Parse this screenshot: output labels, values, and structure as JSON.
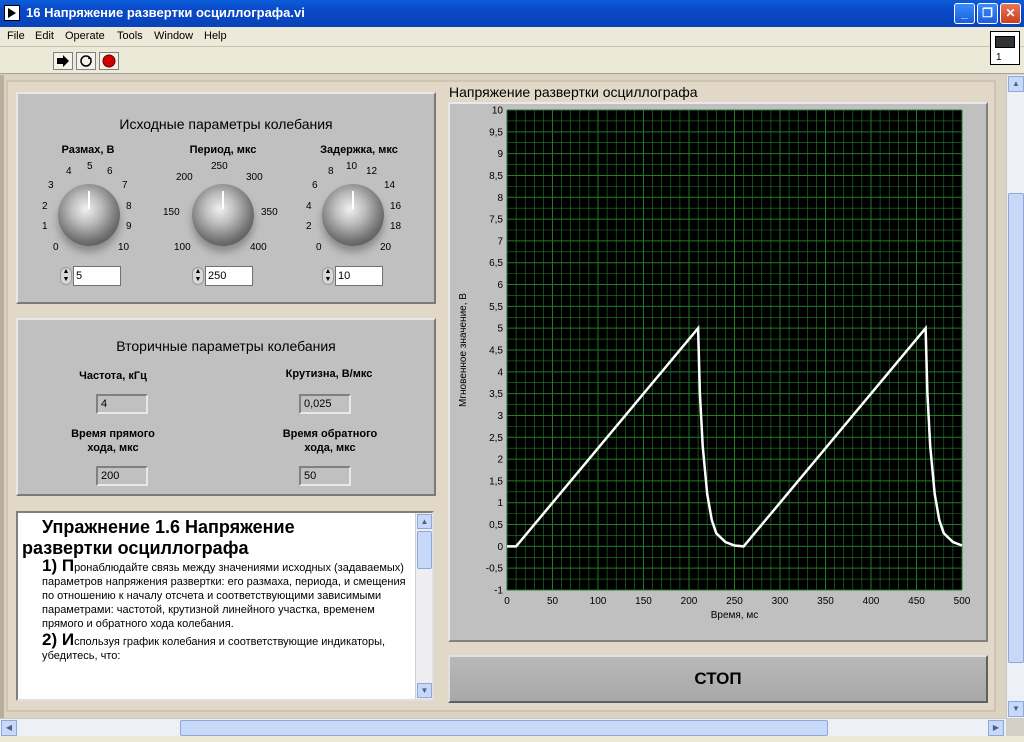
{
  "window": {
    "title": "16 Напряжение развертки осциллографа.vi",
    "min": "_",
    "max": "❐",
    "close": "✕"
  },
  "menu": [
    "File",
    "Edit",
    "Operate",
    "Tools",
    "Window",
    "Help"
  ],
  "vi_icon_number": "1",
  "primary": {
    "title": "Исходные параметры колебания",
    "amplitude": {
      "label": "Размах, В",
      "ticks": [
        "0",
        "1",
        "2",
        "3",
        "4",
        "5",
        "6",
        "7",
        "8",
        "9",
        "10"
      ],
      "value": "5"
    },
    "period": {
      "label": "Период, мкс",
      "ticks": [
        "100",
        "150",
        "200",
        "250",
        "300",
        "350",
        "400"
      ],
      "value": "250"
    },
    "delay": {
      "label": "Задержка, мкс",
      "ticks": [
        "0",
        "2",
        "4",
        "6",
        "8",
        "10",
        "12",
        "14",
        "16",
        "18",
        "20"
      ],
      "value": "10"
    }
  },
  "secondary": {
    "title": "Вторичные параметры колебания",
    "frequency_label": "Частота, кГц",
    "frequency_value": "4",
    "slope_label": "Крутизна, В/мкс",
    "slope_value": "0,025",
    "forward_label_1": "Время прямого",
    "forward_label_2": "хода, мкс",
    "forward_value": "200",
    "reverse_label_1": "Время обратного",
    "reverse_label_2": "хода, мкс",
    "reverse_value": "50"
  },
  "exercise": {
    "heading_1": "Упражнение 1.6 Напряжение",
    "heading_2": "развертки осциллографа",
    "step1_num": "1) П",
    "step1_text": "ронаблюдайте связь между значениями исходных (задаваемых) параметров напряжения развертки: его размаха, периода, и смещения по отношению к началу отсчета и соответствующими зависимыми параметрами: частотой, крутизной линейного участка, временем прямого и обратного хода колебания.",
    "step2_num": "2) И",
    "step2_text": "спользуя график колебания и соответствующие индикаторы, убедитесь, что:"
  },
  "graph_title": "Напряжение развертки осциллографа",
  "stop_label": "СТОП",
  "chart_data": {
    "type": "line",
    "title": "Напряжение развертки осциллографа",
    "xlabel": "Время, мс",
    "ylabel": "Мгновенное значение, В",
    "xlim": [
      0,
      500
    ],
    "ylim": [
      -1,
      10
    ],
    "xticks": [
      0,
      50,
      100,
      150,
      200,
      250,
      300,
      350,
      400,
      450,
      500
    ],
    "yticks": [
      -1,
      -0.5,
      0,
      0.5,
      1,
      1.5,
      2,
      2.5,
      3,
      3.5,
      4,
      4.5,
      5,
      5.5,
      6,
      6.5,
      7,
      7.5,
      8,
      8.5,
      9,
      9.5,
      10
    ],
    "ytick_labels": [
      "-1",
      "-0,5",
      "0",
      "0,5",
      "1",
      "1,5",
      "2",
      "2,5",
      "3",
      "3,5",
      "4",
      "4,5",
      "5",
      "5,5",
      "6",
      "6,5",
      "7",
      "7,5",
      "8",
      "8,5",
      "9",
      "9,5",
      "10"
    ],
    "grid": true,
    "background": "#000000",
    "grid_color": "#1e7d28",
    "line_color": "#ffffff",
    "series": [
      {
        "x": [
          0,
          10,
          210,
          212,
          215,
          220,
          225,
          230,
          240,
          250,
          260,
          460,
          462,
          465,
          470,
          475,
          480,
          490,
          500
        ],
        "y": [
          0,
          0,
          5,
          3.5,
          2.3,
          1.2,
          0.6,
          0.3,
          0.1,
          0.02,
          0,
          5,
          3.5,
          2.3,
          1.2,
          0.6,
          0.3,
          0.1,
          0.02
        ]
      }
    ]
  }
}
